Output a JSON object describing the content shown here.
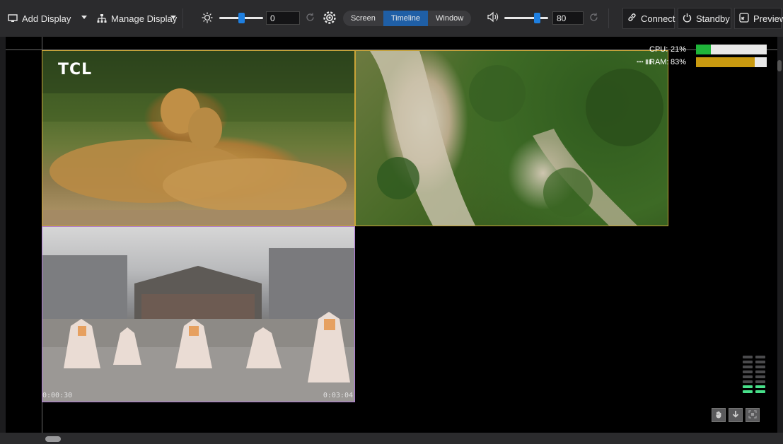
{
  "toolbar": {
    "add_display": {
      "label": "Add Display",
      "icon": "monitor-icon"
    },
    "manage_display": {
      "label": "Manage Display",
      "icon": "sitemap-icon"
    },
    "brightness": {
      "icon": "sun-icon",
      "value": "0",
      "level": 0.5
    },
    "view_modes": {
      "icon": "view-gear-icon",
      "options": [
        "Screen",
        "Timeline",
        "Window"
      ],
      "selected": "Timeline"
    },
    "volume": {
      "icon": "speaker-icon",
      "value": "80",
      "level": 0.8
    },
    "connect": {
      "label": "Connect",
      "icon": "link-icon"
    },
    "standby": {
      "label": "Standby",
      "icon": "power-icon"
    },
    "preview": {
      "label": "Preview",
      "icon": "preview-icon"
    }
  },
  "stage": {
    "videos": [
      {
        "overlay_text": "TCL",
        "description_icon": "cheetah-video"
      },
      {
        "overlay_text": "",
        "description_icon": "aerial-forest-video"
      },
      {
        "overlay_text": "",
        "time_start": "0:00:30",
        "time_end": "0:03:04",
        "description_icon": "dancers-video"
      }
    ]
  },
  "stats": {
    "cpu": {
      "label": "CPU:",
      "value": "21%",
      "level": 0.21,
      "color": "#1fb53a"
    },
    "ram": {
      "label": "RAM:",
      "value": "83%",
      "level": 0.83,
      "color": "#c99a10"
    }
  },
  "colors": {
    "accent": "#1f5fa6",
    "slider_thumb": "#1e7fe0",
    "meter_on": "#48e08a"
  }
}
